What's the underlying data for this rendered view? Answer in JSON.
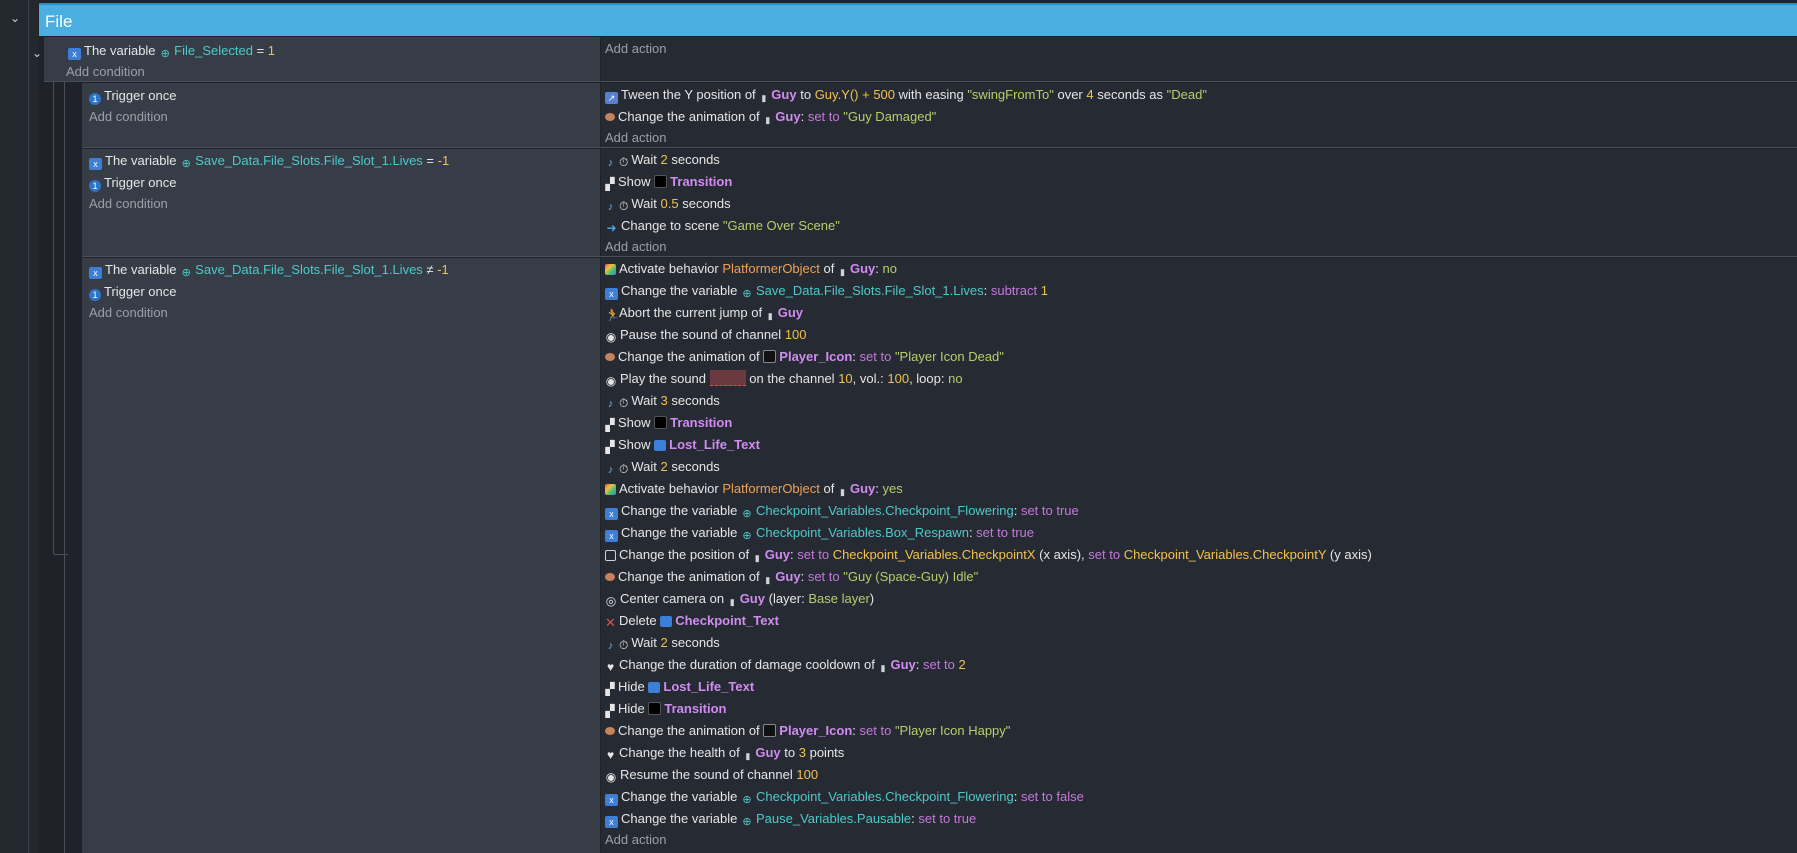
{
  "group_title": "File",
  "add_condition": "Add condition",
  "add_action": "Add action",
  "event1": {
    "cond_text": "The variable",
    "cond_var": "File_Selected",
    "cond_op": "=",
    "cond_val": "1"
  },
  "event2": {
    "trigger": "Trigger once",
    "a1_pre": "Tween the Y position of",
    "a1_obj": "Guy",
    "a1_to": "to",
    "a1_expr": "Guy.Y() + 500",
    "a1_with": "with easing",
    "a1_easing": "\"swingFromTo\"",
    "a1_over": "over",
    "a1_dur": "4",
    "a1_as": "seconds as",
    "a1_name": "\"Dead\"",
    "a2_pre": "Change the animation of",
    "a2_obj": "Guy",
    "a2_set": "set to",
    "a2_val": "\"Guy Damaged\""
  },
  "event3": {
    "cond_text": "The variable",
    "cond_var": "Save_Data.File_Slots.File_Slot_1.Lives",
    "cond_op": "=",
    "cond_val": "-1",
    "trigger": "Trigger once",
    "a1_pre": "Wait",
    "a1_val": "2",
    "a1_post": "seconds",
    "a2_pre": "Show",
    "a2_obj": "Transition",
    "a3_pre": "Wait",
    "a3_val": "0.5",
    "a3_post": "seconds",
    "a4_pre": "Change to scene",
    "a4_val": "\"Game Over Scene\""
  },
  "event4": {
    "cond_text": "The variable",
    "cond_var": "Save_Data.File_Slots.File_Slot_1.Lives",
    "cond_op": "≠",
    "cond_val": "-1",
    "trigger": "Trigger once",
    "actions": {
      "l1_pre": "Activate behavior",
      "l1_beh": "PlatformerObject",
      "l1_of": "of",
      "l1_obj": "Guy",
      "l1_val": "no",
      "l2_pre": "Change the variable",
      "l2_var": "Save_Data.File_Slots.File_Slot_1.Lives",
      "l2_op": "subtract",
      "l2_val": "1",
      "l3_pre": "Abort the current jump of",
      "l3_obj": "Guy",
      "l4_pre": "Pause the sound of channel",
      "l4_val": "100",
      "l5_pre": "Change the animation of",
      "l5_obj": "Player_Icon",
      "l5_set": "set to",
      "l5_val": "\"Player Icon Dead\"",
      "l6_pre": "Play the sound",
      "l6_mid": "on the channel",
      "l6_ch": "10",
      "l6_vol": "vol.:",
      "l6_volv": "100",
      "l6_loop": "loop:",
      "l6_loopv": "no",
      "l7_pre": "Wait",
      "l7_val": "3",
      "l7_post": "seconds",
      "l8_pre": "Show",
      "l8_obj": "Transition",
      "l9_pre": "Show",
      "l9_obj": "Lost_Life_Text",
      "l10_pre": "Wait",
      "l10_val": "2",
      "l10_post": "seconds",
      "l11_pre": "Activate behavior",
      "l11_beh": "PlatformerObject",
      "l11_of": "of",
      "l11_obj": "Guy",
      "l11_val": "yes",
      "l12_pre": "Change the variable",
      "l12_var": "Checkpoint_Variables.Checkpoint_Flowering",
      "l12_op": "set to true",
      "l13_pre": "Change the variable",
      "l13_var": "Checkpoint_Variables.Box_Respawn",
      "l13_op": "set to true",
      "l14_pre": "Change the position of",
      "l14_obj": "Guy",
      "l14_set": "set to",
      "l14_x": "Checkpoint_Variables.CheckpointX",
      "l14_xaxis": "(x axis),",
      "l14_set2": "set to",
      "l14_y": "Checkpoint_Variables.CheckpointY",
      "l14_yaxis": "(y axis)",
      "l15_pre": "Change the animation of",
      "l15_obj": "Guy",
      "l15_set": "set to",
      "l15_val": "\"Guy (Space-Guy) Idle\"",
      "l16_pre": "Center camera on",
      "l16_obj": "Guy",
      "l16_layer": "(layer:",
      "l16_layerv": "Base layer",
      "l16_end": ")",
      "l17_pre": "Delete",
      "l17_obj": "Checkpoint_Text",
      "l18_pre": "Wait",
      "l18_val": "2",
      "l18_post": "seconds",
      "l19_pre": "Change the duration of damage cooldown of",
      "l19_obj": "Guy",
      "l19_set": "set to",
      "l19_val": "2",
      "l20_pre": "Hide",
      "l20_obj": "Lost_Life_Text",
      "l21_pre": "Hide",
      "l21_obj": "Transition",
      "l22_pre": "Change the animation of",
      "l22_obj": "Player_Icon",
      "l22_set": "set to",
      "l22_val": "\"Player Icon Happy\"",
      "l23_pre": "Change the health of",
      "l23_obj": "Guy",
      "l23_to": "to",
      "l23_val": "3",
      "l23_post": "points",
      "l24_pre": "Resume the sound of channel",
      "l24_val": "100",
      "l25_pre": "Change the variable",
      "l25_var": "Checkpoint_Variables.Checkpoint_Flowering",
      "l25_op": "set to false",
      "l26_pre": "Change the variable",
      "l26_var": "Pause_Variables.Pausable",
      "l26_op": "set to true"
    }
  }
}
